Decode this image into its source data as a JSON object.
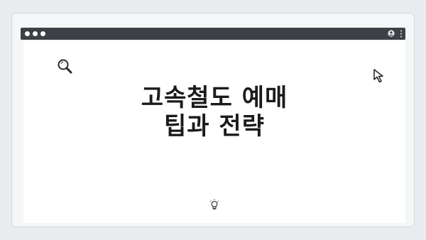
{
  "slide": {
    "title_line1": "고속철도 예매",
    "title_line2": "팁과 전략"
  },
  "icons": {
    "top": "carousel-dots",
    "window_buttons": "traffic-light-dots",
    "profile": "profile-icon",
    "menu": "kebab-menu-icon",
    "search": "search-icon",
    "cursor": "cursor-icon",
    "bulb": "lightbulb-icon"
  },
  "colors": {
    "background": "#e9edf0",
    "titlebar": "#3d4146",
    "content": "#ffffff",
    "text": "#1b1b1b"
  }
}
